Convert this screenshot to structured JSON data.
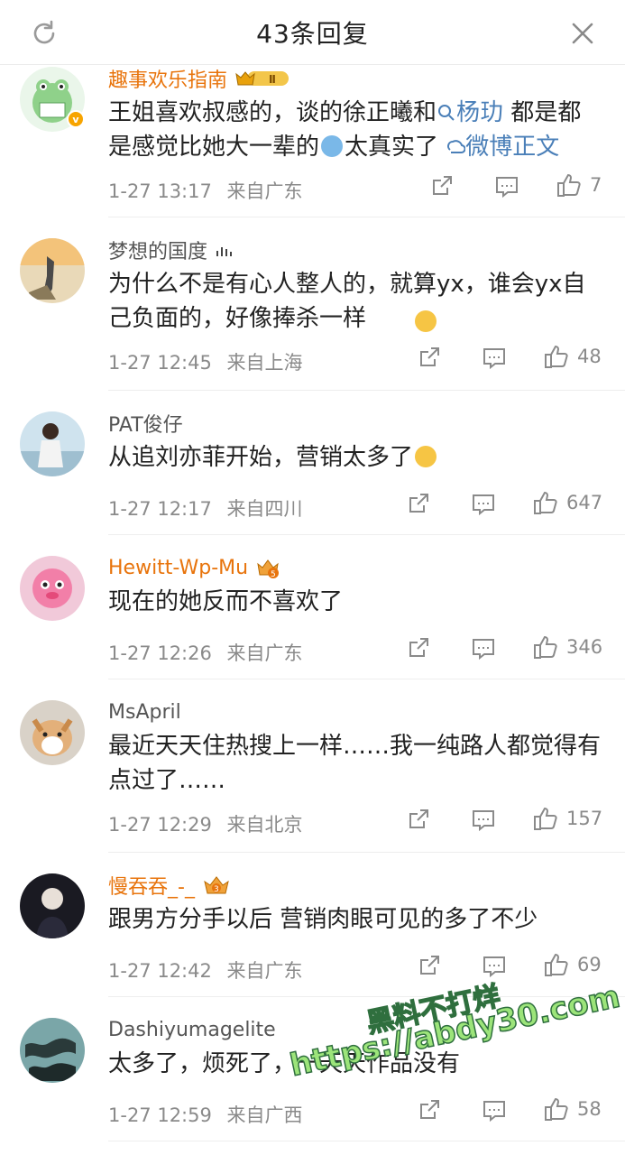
{
  "header": {
    "title": "43条回复",
    "refresh_icon": "refresh-icon",
    "close_icon": "close-icon"
  },
  "comments": [
    {
      "username": "趣事欢乐指南",
      "name_color": "#e8740c",
      "vip_badge": "crown-level-II-icon",
      "verified": true,
      "text_parts": [
        "王姐喜欢叔感的，谈的徐正曦和",
        "杨玏",
        "都是感觉比她大一辈的",
        "太真实了",
        "微博正文"
      ],
      "date": "1-27 13:17",
      "location": "来自广东",
      "likes": "7"
    },
    {
      "username": "梦想的国度",
      "name_color": "#555555",
      "text_parts": [
        "为什么不是有心人整人的，就算yx，谁会yx自己负面的，好像捧杀一样"
      ],
      "date": "1-27 12:45",
      "location": "来自上海",
      "likes": "48"
    },
    {
      "username": "PAT俊仔",
      "name_color": "#555555",
      "text_parts": [
        "从追刘亦菲开始，营销太多了"
      ],
      "date": "1-27 12:17",
      "location": "来自四川",
      "likes": "647"
    },
    {
      "username": "Hewitt-Wp-Mu",
      "name_color": "#e8740c",
      "vip_badge": "crown-level-5-icon",
      "text_parts": [
        "现在的她反而不喜欢了"
      ],
      "date": "1-27 12:26",
      "location": "来自广东",
      "likes": "346"
    },
    {
      "username": "MsApril",
      "name_color": "#555555",
      "text_parts": [
        "最近天天住热搜上一样……我一纯路人都觉得有点过了……"
      ],
      "date": "1-27 12:29",
      "location": "来自北京",
      "likes": "157"
    },
    {
      "username": "慢吞吞_-_",
      "name_color": "#e8740c",
      "vip_badge": "crown-level-3-icon",
      "text_parts": [
        "跟男方分手以后 营销肉眼可见的多了不少"
      ],
      "date": "1-27 12:42",
      "location": "来自广东",
      "likes": "69"
    },
    {
      "username": "Dashiyumagelite",
      "name_color": "#555555",
      "text_parts": [
        "太多了，烦死了，一天天作品没有"
      ],
      "date": "1-27 12:59",
      "location": "来自广西",
      "likes": "58"
    }
  ],
  "icons": {
    "share": "share-icon",
    "comment": "comment-icon",
    "like": "thumbs-up-icon"
  },
  "watermark": {
    "line1": "黑料不打烊",
    "line2": "https://abdy30.com"
  }
}
